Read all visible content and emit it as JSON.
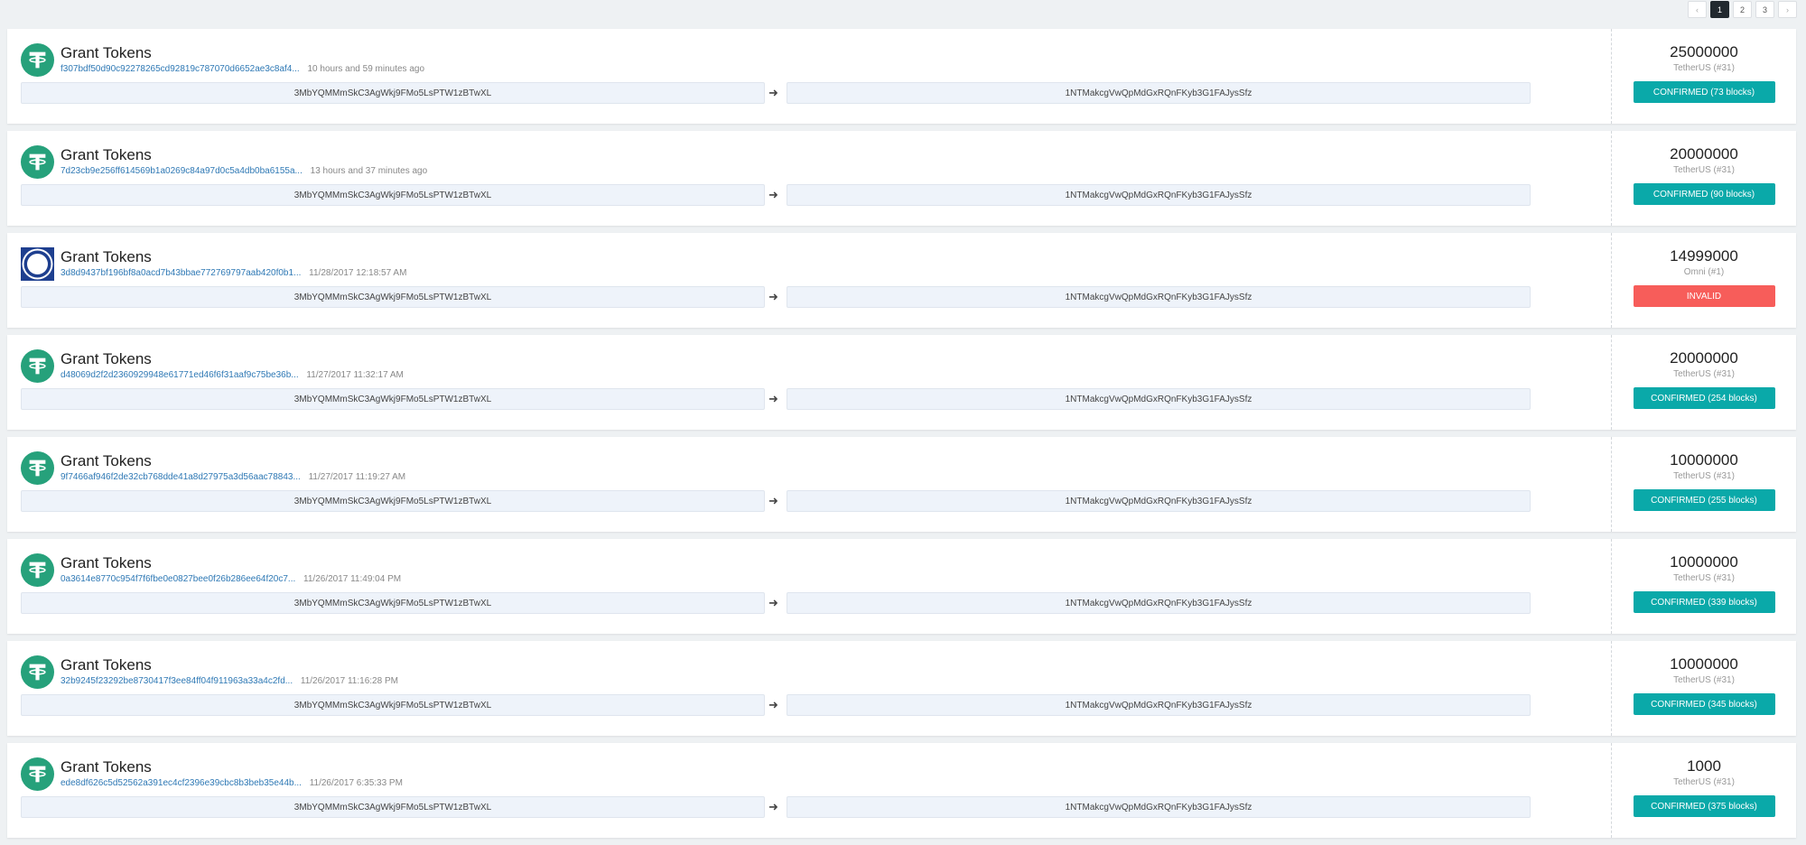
{
  "pagination": {
    "prev": "‹",
    "pages": [
      "1",
      "2",
      "3"
    ],
    "active": "1",
    "next": "›"
  },
  "colors": {
    "tether_green": "#26a17b",
    "omni_blue": "#1e3f8f",
    "confirmed": "#0aa9a9",
    "invalid": "#f75d5a",
    "hash_link": "#2f79b5"
  },
  "transactions": [
    {
      "icon": "tether-logo-icon",
      "type": "Grant Tokens",
      "hash": "f307bdf50d90c92278265cd92819c787070d6652ae3c8af4...",
      "time": "10 hours and 59 minutes ago",
      "from": "3MbYQMMmSkC3AgWkj9FMo5LsPTW1zBTwXL",
      "to": "1NTMakcgVwQpMdGxRQnFKyb3G1FAJysSfz",
      "amount": "25000000",
      "property": "TetherUS (#31)",
      "status": "CONFIRMED (73 blocks)",
      "status_kind": "ok"
    },
    {
      "icon": "tether-logo-icon",
      "type": "Grant Tokens",
      "hash": "7d23cb9e256ff614569b1a0269c84a97d0c5a4db0ba6155a...",
      "time": "13 hours and 37 minutes ago",
      "from": "3MbYQMMmSkC3AgWkj9FMo5LsPTW1zBTwXL",
      "to": "1NTMakcgVwQpMdGxRQnFKyb3G1FAJysSfz",
      "amount": "20000000",
      "property": "TetherUS (#31)",
      "status": "CONFIRMED (90 blocks)",
      "status_kind": "ok"
    },
    {
      "icon": "omni-logo-icon",
      "type": "Grant Tokens",
      "hash": "3d8d9437bf196bf8a0acd7b43bbae772769797aab420f0b1...",
      "time": "11/28/2017 12:18:57 AM",
      "from": "3MbYQMMmSkC3AgWkj9FMo5LsPTW1zBTwXL",
      "to": "1NTMakcgVwQpMdGxRQnFKyb3G1FAJysSfz",
      "amount": "14999000",
      "property": "Omni (#1)",
      "status": "INVALID",
      "status_kind": "bad"
    },
    {
      "icon": "tether-logo-icon",
      "type": "Grant Tokens",
      "hash": "d48069d2f2d2360929948e61771ed46f6f31aaf9c75be36b...",
      "time": "11/27/2017 11:32:17 AM",
      "from": "3MbYQMMmSkC3AgWkj9FMo5LsPTW1zBTwXL",
      "to": "1NTMakcgVwQpMdGxRQnFKyb3G1FAJysSfz",
      "amount": "20000000",
      "property": "TetherUS (#31)",
      "status": "CONFIRMED (254 blocks)",
      "status_kind": "ok"
    },
    {
      "icon": "tether-logo-icon",
      "type": "Grant Tokens",
      "hash": "9f7466af946f2de32cb768dde41a8d27975a3d56aac78843...",
      "time": "11/27/2017 11:19:27 AM",
      "from": "3MbYQMMmSkC3AgWkj9FMo5LsPTW1zBTwXL",
      "to": "1NTMakcgVwQpMdGxRQnFKyb3G1FAJysSfz",
      "amount": "10000000",
      "property": "TetherUS (#31)",
      "status": "CONFIRMED (255 blocks)",
      "status_kind": "ok"
    },
    {
      "icon": "tether-logo-icon",
      "type": "Grant Tokens",
      "hash": "0a3614e8770c954f7f6fbe0e0827bee0f26b286ee64f20c7...",
      "time": "11/26/2017 11:49:04 PM",
      "from": "3MbYQMMmSkC3AgWkj9FMo5LsPTW1zBTwXL",
      "to": "1NTMakcgVwQpMdGxRQnFKyb3G1FAJysSfz",
      "amount": "10000000",
      "property": "TetherUS (#31)",
      "status": "CONFIRMED (339 blocks)",
      "status_kind": "ok"
    },
    {
      "icon": "tether-logo-icon",
      "type": "Grant Tokens",
      "hash": "32b9245f23292be8730417f3ee84ff04f911963a33a4c2fd...",
      "time": "11/26/2017 11:16:28 PM",
      "from": "3MbYQMMmSkC3AgWkj9FMo5LsPTW1zBTwXL",
      "to": "1NTMakcgVwQpMdGxRQnFKyb3G1FAJysSfz",
      "amount": "10000000",
      "property": "TetherUS (#31)",
      "status": "CONFIRMED (345 blocks)",
      "status_kind": "ok"
    },
    {
      "icon": "tether-logo-icon",
      "type": "Grant Tokens",
      "hash": "ede8df626c5d52562a391ec4cf2396e39cbc8b3beb35e44b...",
      "time": "11/26/2017 6:35:33 PM",
      "from": "3MbYQMMmSkC3AgWkj9FMo5LsPTW1zBTwXL",
      "to": "1NTMakcgVwQpMdGxRQnFKyb3G1FAJysSfz",
      "amount": "1000",
      "property": "TetherUS (#31)",
      "status": "CONFIRMED (375 blocks)",
      "status_kind": "ok"
    }
  ]
}
